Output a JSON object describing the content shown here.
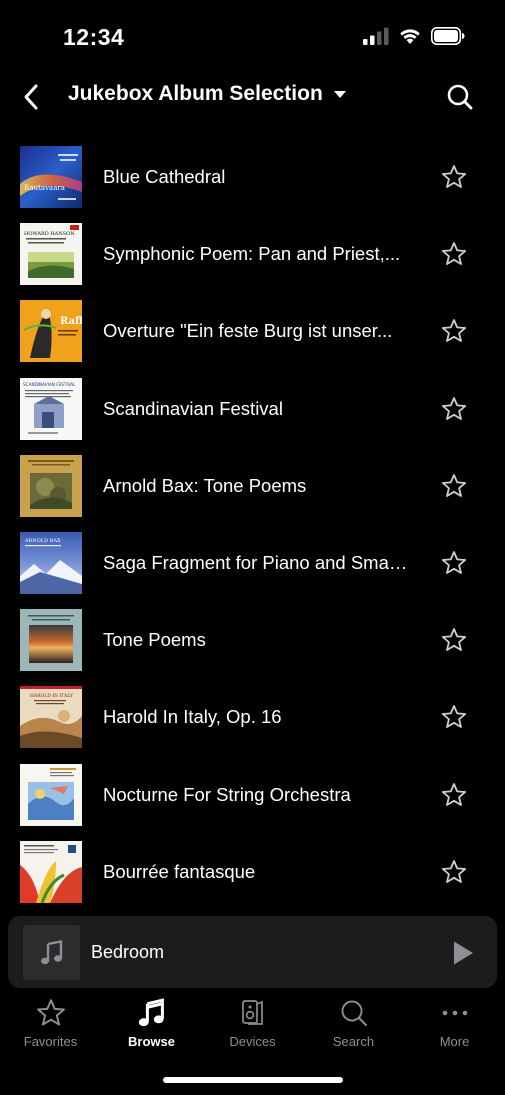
{
  "status_bar": {
    "time": "12:34"
  },
  "header": {
    "title": "Jukebox Album Selection"
  },
  "albums": [
    {
      "title": "Blue Cathedral",
      "art_text": "Rautavaara"
    },
    {
      "title": "Symphonic Poem: Pan and Priest,...",
      "art_text": "HOWARD HANSON"
    },
    {
      "title": "Overture \"Ein feste Burg ist unser...",
      "art_text": "Raff"
    },
    {
      "title": "Scandinavian Festival",
      "art_text": "SCANDINAVIAN FESTIVAL"
    },
    {
      "title": "Arnold Bax: Tone Poems",
      "art_text": ""
    },
    {
      "title": "Saga Fragment for Piano and Smal...",
      "art_text": "ARNOLD BAX"
    },
    {
      "title": "Tone Poems",
      "art_text": ""
    },
    {
      "title": "Harold In Italy, Op. 16",
      "art_text": "HAROLD IN ITALY"
    },
    {
      "title": "Nocturne For String Orchestra",
      "art_text": ""
    },
    {
      "title": "Bourrée fantasque",
      "art_text": ""
    }
  ],
  "mini_player": {
    "title": "Bedroom"
  },
  "tabs": [
    {
      "label": "Favorites",
      "icon": "star-icon",
      "active": false
    },
    {
      "label": "Browse",
      "icon": "music-note-icon",
      "active": true
    },
    {
      "label": "Devices",
      "icon": "speaker-icon",
      "active": false
    },
    {
      "label": "Search",
      "icon": "search-icon",
      "active": false
    },
    {
      "label": "More",
      "icon": "more-icon",
      "active": false
    }
  ],
  "colors": {
    "background": "#000000",
    "player_bg": "#1c1c1e",
    "inactive": "#8e8e93"
  }
}
